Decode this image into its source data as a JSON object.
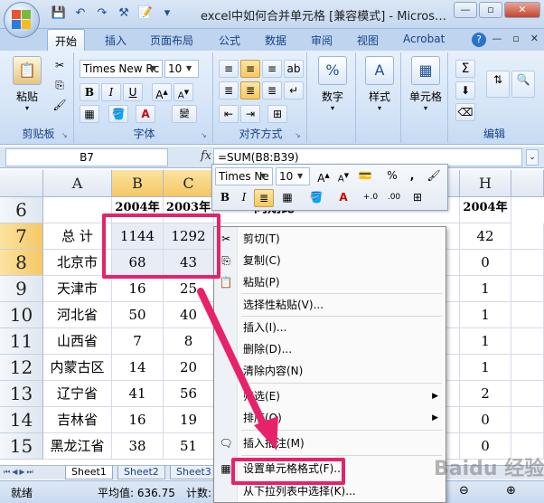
{
  "window": {
    "title": "excel中如何合并单元格 [兼容模式] - Micros…",
    "buttons": [
      "—",
      "▫",
      "✕"
    ]
  },
  "ribbon_tabs": [
    "开始",
    "插入",
    "页面布局",
    "公式",
    "数据",
    "审阅",
    "视图",
    "Acrobat"
  ],
  "ribbon": {
    "clipboard": {
      "label": "剪贴板",
      "paste": "粘贴"
    },
    "font": {
      "label": "字体",
      "name": "Times New Rc",
      "size": "10"
    },
    "alignment": {
      "label": "对齐方式"
    },
    "number": {
      "label": "数字",
      "percent": "%"
    },
    "styles": {
      "label": "样式"
    },
    "cells": {
      "label": "单元格"
    },
    "editing": {
      "label": "编辑",
      "sigma": "Σ"
    }
  },
  "formula_bar": {
    "name_box": "B7",
    "fx": "fx",
    "formula": "=SUM(B8:B39)"
  },
  "columns": [
    "A",
    "B",
    "C",
    "H"
  ],
  "rows": [
    {
      "num": "6",
      "a": "",
      "b": "2004年",
      "c": "2003年",
      "h": "2004年"
    },
    {
      "num": "7",
      "a": "总    计",
      "b": "1144",
      "c": "1292",
      "h": "42"
    },
    {
      "num": "8",
      "a": "北京市",
      "b": "68",
      "c": "43",
      "h": "0"
    },
    {
      "num": "9",
      "a": "天津市",
      "b": "16",
      "c": "25",
      "h": "1"
    },
    {
      "num": "10",
      "a": "河北省",
      "b": "50",
      "c": "40",
      "h": "1"
    },
    {
      "num": "11",
      "a": "山西省",
      "b": "7",
      "c": "8",
      "h": "1"
    },
    {
      "num": "12",
      "a": "内蒙古区",
      "b": "14",
      "c": "20",
      "h": "1"
    },
    {
      "num": "13",
      "a": "辽宁省",
      "b": "41",
      "c": "56",
      "h": "2"
    },
    {
      "num": "14",
      "a": "吉林省",
      "b": "16",
      "c": "19",
      "h": "0"
    },
    {
      "num": "15",
      "a": "黑龙江省",
      "b": "38",
      "c": "51",
      "h": "0"
    }
  ],
  "partial_headers": {
    "g6": "同期比"
  },
  "mini_toolbar": {
    "font": "Times Ne",
    "size": "10",
    "percent": "%",
    "comma": ","
  },
  "context_menu": [
    {
      "label": "剪切(T)",
      "icon": "scissors-icon"
    },
    {
      "label": "复制(C)",
      "icon": "copy-icon"
    },
    {
      "label": "粘贴(P)",
      "icon": "paste-icon"
    },
    {
      "label": "选择性粘贴(V)...",
      "icon": ""
    },
    {
      "label": "插入(I)...",
      "icon": ""
    },
    {
      "label": "删除(D)...",
      "icon": ""
    },
    {
      "label": "清除内容(N)",
      "icon": ""
    },
    {
      "label": "筛选(E)",
      "icon": "",
      "submenu": true
    },
    {
      "label": "排序(O)",
      "icon": "",
      "submenu": true
    },
    {
      "label": "插入批注(M)",
      "icon": "comment-icon"
    },
    {
      "label": "设置单元格格式(F)...",
      "icon": "format-cells-icon"
    },
    {
      "label": "从下拉列表中选择(K)...",
      "icon": ""
    }
  ],
  "sheets": [
    "Sheet1",
    "Sheet2",
    "Sheet3"
  ],
  "status": {
    "ready": "就绪",
    "average": "平均值: 636.75",
    "count": "计数:"
  },
  "watermark": "Baidu 经验",
  "colors": {
    "highlight": "#e8216b",
    "ribbon": "#d3e3f6",
    "accent": "#15428b"
  }
}
